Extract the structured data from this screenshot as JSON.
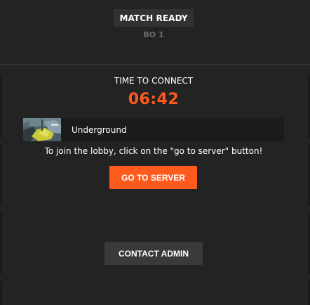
{
  "header": {
    "status_badge": "MATCH READY",
    "format": "BO 1"
  },
  "connect": {
    "title": "TIME TO CONNECT",
    "countdown": "06:42",
    "countdown_color": "#ff5a1e"
  },
  "map": {
    "name": "Underground",
    "thumbnail_icon": "map-thumbnail"
  },
  "instructions": "To join the lobby, click on the \"go to server\" button!",
  "buttons": {
    "go_to_server": "GO TO SERVER",
    "contact_admin": "CONTACT ADMIN"
  },
  "colors": {
    "background": "#232323",
    "accent": "#ff5a1e",
    "panel": "#1b1b1b",
    "secondary_button": "#3a3a3a"
  }
}
